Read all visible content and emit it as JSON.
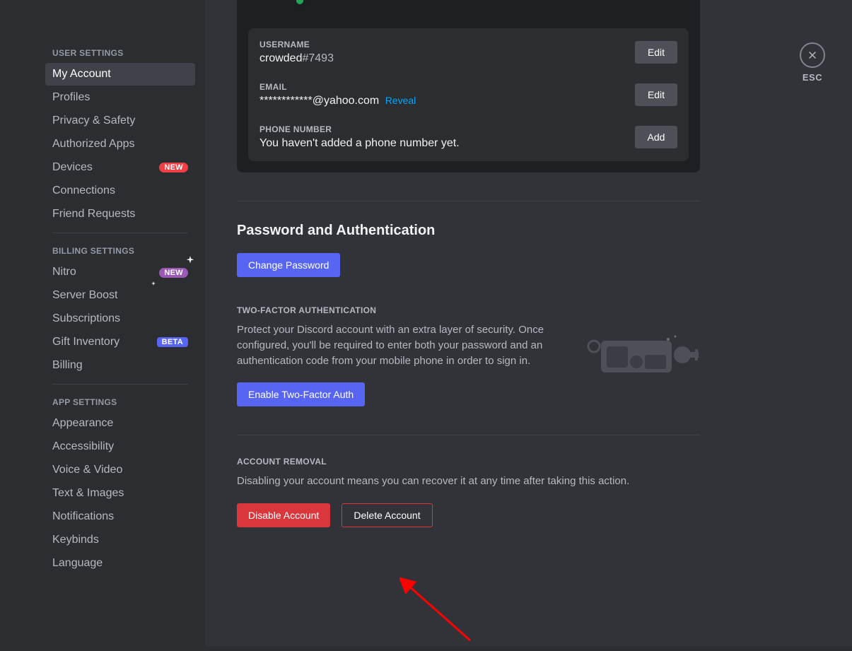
{
  "sidebar": {
    "headers": {
      "user": "USER SETTINGS",
      "billing": "BILLING SETTINGS",
      "app": "APP SETTINGS"
    },
    "items": {
      "myAccount": "My Account",
      "profiles": "Profiles",
      "privacy": "Privacy & Safety",
      "authApps": "Authorized Apps",
      "devices": "Devices",
      "connections": "Connections",
      "friendReq": "Friend Requests",
      "nitro": "Nitro",
      "serverBoost": "Server Boost",
      "subscriptions": "Subscriptions",
      "giftInv": "Gift Inventory",
      "billing": "Billing",
      "appearance": "Appearance",
      "accessibility": "Accessibility",
      "voiceVideo": "Voice & Video",
      "textImages": "Text & Images",
      "notifications": "Notifications",
      "keybinds": "Keybinds",
      "language": "Language"
    },
    "badges": {
      "new": "NEW",
      "beta": "BETA"
    }
  },
  "account": {
    "usernameLabel": "USERNAME",
    "usernameName": "crowded",
    "usernameTag": "#7493",
    "emailLabel": "EMAIL",
    "emailMasked": "************@yahoo.com",
    "reveal": "Reveal",
    "phoneLabel": "PHONE NUMBER",
    "phoneValue": "You haven't added a phone number yet.",
    "editBtn": "Edit",
    "addBtn": "Add"
  },
  "password": {
    "title": "Password and Authentication",
    "changeBtn": "Change Password",
    "twoFaHeader": "TWO-FACTOR AUTHENTICATION",
    "twoFaDesc": "Protect your Discord account with an extra layer of security. Once configured, you'll be required to enter both your password and an authentication code from your mobile phone in order to sign in.",
    "enableBtn": "Enable Two-Factor Auth"
  },
  "removal": {
    "header": "ACCOUNT REMOVAL",
    "desc": "Disabling your account means you can recover it at any time after taking this action.",
    "disableBtn": "Disable Account",
    "deleteBtn": "Delete Account"
  },
  "close": {
    "label": "ESC"
  }
}
